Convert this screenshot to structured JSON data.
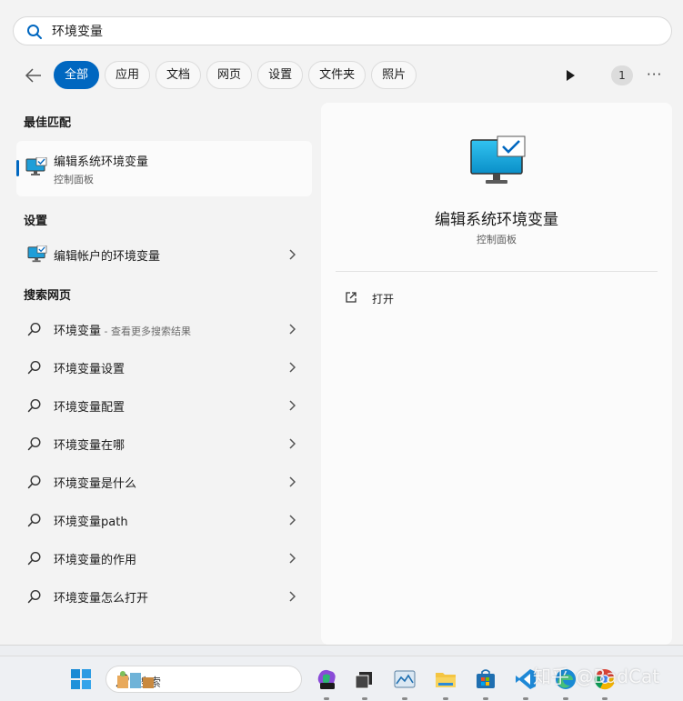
{
  "search": {
    "query": "环境变量"
  },
  "filters": {
    "tabs": [
      {
        "label": "全部",
        "active": true
      },
      {
        "label": "应用"
      },
      {
        "label": "文档"
      },
      {
        "label": "网页"
      },
      {
        "label": "设置"
      },
      {
        "label": "文件夹"
      },
      {
        "label": "照片"
      }
    ],
    "badge_count": "1",
    "more_label": "···"
  },
  "sections": {
    "best_match": "最佳匹配",
    "settings": "设置",
    "web": "搜索网页"
  },
  "best_match": {
    "title": "编辑系统环境变量",
    "subtitle": "控制面板",
    "icon": "monitor-check-icon"
  },
  "settings_items": [
    {
      "label": "编辑帐户的环境变量",
      "icon": "monitor-check-icon"
    }
  ],
  "web_items": [
    {
      "label": "环境变量",
      "hint": " - 查看更多搜索结果"
    },
    {
      "label": "环境变量设置"
    },
    {
      "label": "环境变量配置"
    },
    {
      "label": "环境变量在哪"
    },
    {
      "label": "环境变量是什么"
    },
    {
      "label": "环境变量path"
    },
    {
      "label": "环境变量的作用"
    },
    {
      "label": "环境变量怎么打开"
    }
  ],
  "preview": {
    "title": "编辑系统环境变量",
    "subtitle": "控制面板",
    "actions": [
      {
        "label": "打开",
        "icon": "open-external-icon"
      }
    ]
  },
  "taskbar": {
    "search_label": "搜索",
    "apps": [
      "windows-start-icon",
      "copilot-icon",
      "terminal-icon",
      "photos-icon",
      "file-explorer-icon",
      "microsoft-store-icon",
      "vscode-icon",
      "edge-icon",
      "chrome-icon"
    ]
  },
  "watermark": "知乎 @BadCat",
  "colors": {
    "accent": "#0067c0",
    "panel": "#f3f3f3",
    "preview_bg": "#fbfbfb"
  }
}
